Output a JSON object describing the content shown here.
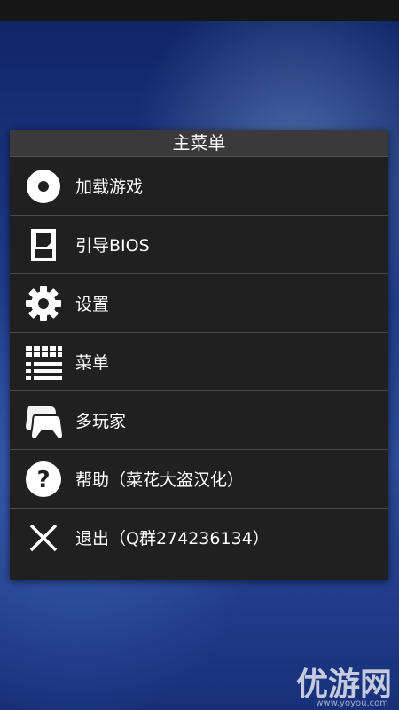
{
  "dialog": {
    "title": "主菜单",
    "items": [
      {
        "label": "加载游戏",
        "icon": "disc-icon"
      },
      {
        "label": "引导BIOS",
        "icon": "memory-card-icon"
      },
      {
        "label": "设置",
        "icon": "gear-icon"
      },
      {
        "label": "菜单",
        "icon": "grid-menu-icon"
      },
      {
        "label": "多玩家",
        "icon": "gamepad-icon"
      },
      {
        "label": "帮助（菜花大盗汉化）",
        "icon": "help-icon"
      },
      {
        "label": "退出（Q群274236134）",
        "icon": "close-icon"
      }
    ]
  },
  "watermark": {
    "text": "优游网",
    "url": "www.yoyou.com"
  }
}
